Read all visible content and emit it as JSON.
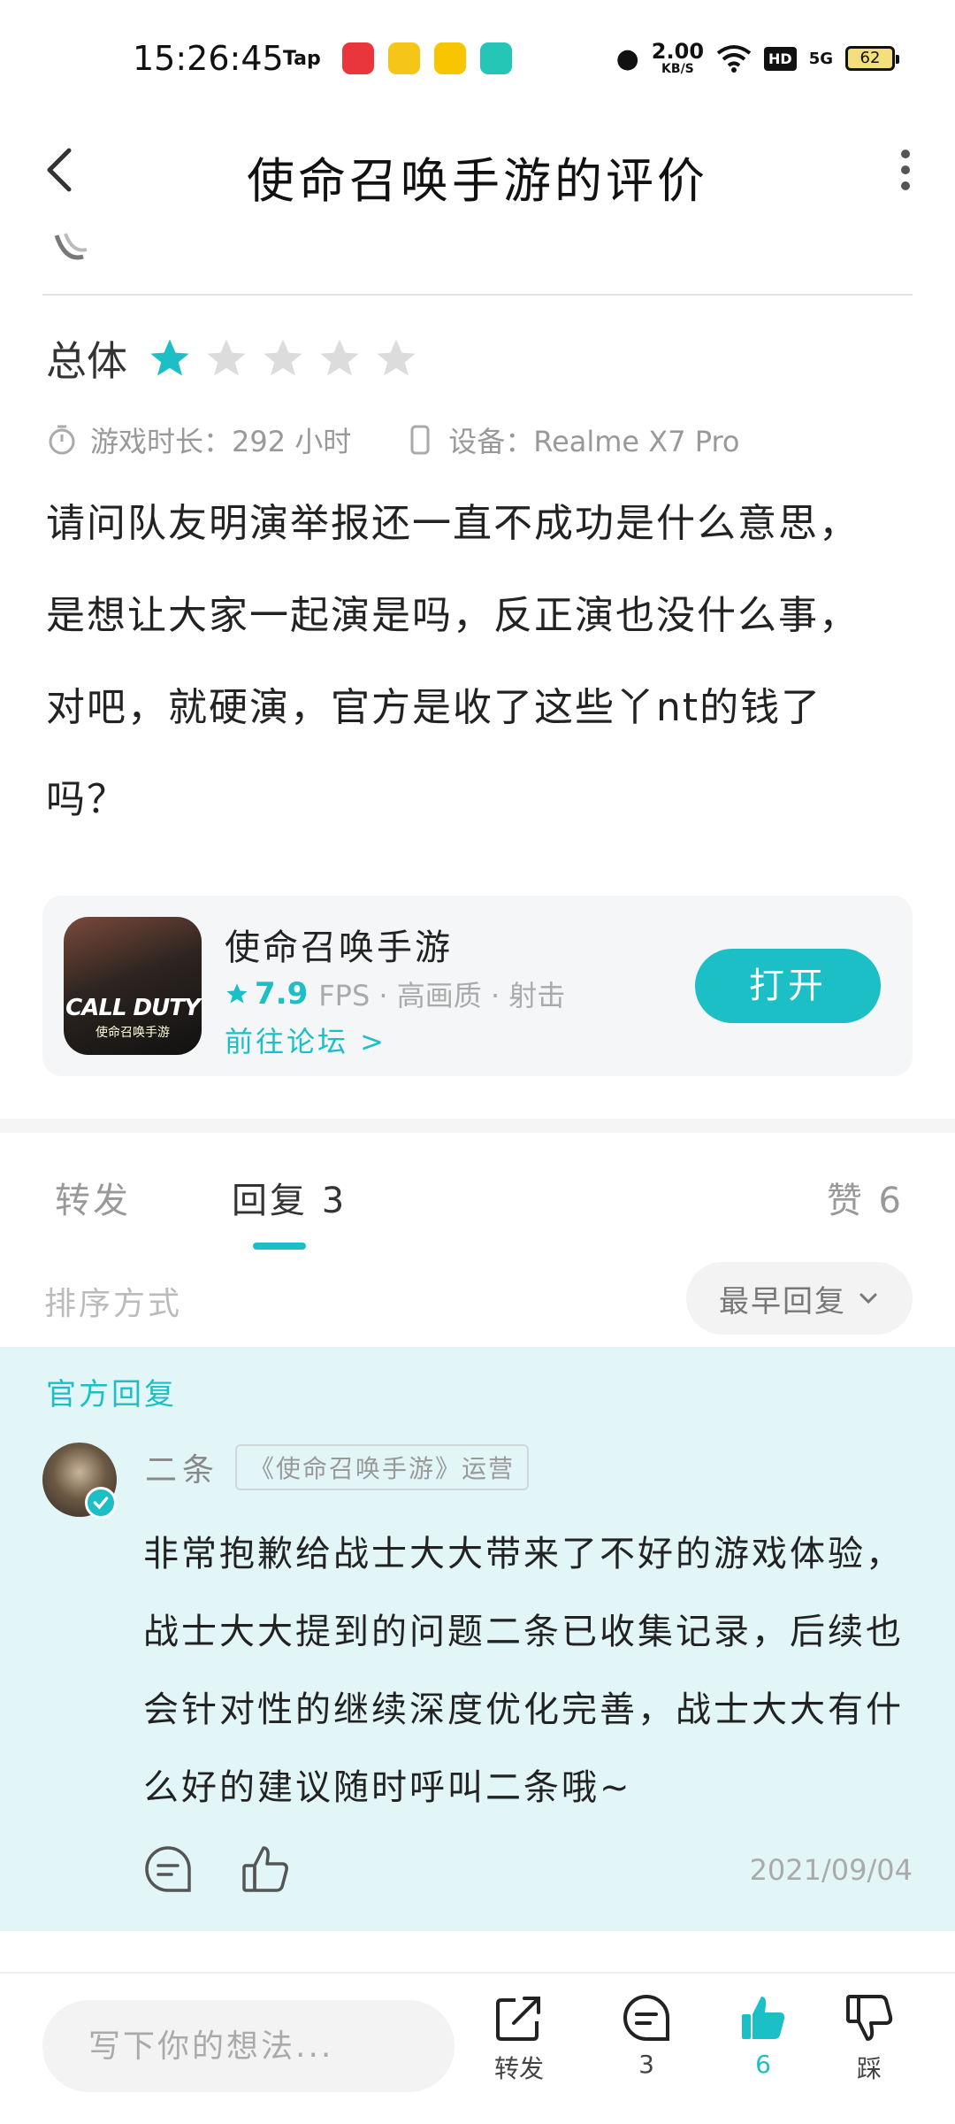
{
  "status_bar": {
    "time": "15:26:45",
    "tap_label": "Tap",
    "speed_value": "2.00",
    "speed_unit": "KB/S",
    "hd": "HD",
    "network": "5G",
    "battery": "62"
  },
  "nav": {
    "title": "使命召唤手游的评价"
  },
  "review": {
    "rating_label": "总体",
    "rating_value": 1,
    "rating_max": 5,
    "playtime": "游戏时长：292 小时",
    "device": "设备：Realme X7 Pro",
    "text": "请问队友明演举报还一直不成功是什么意思，是想让大家一起演是吗，反正演也没什么事，对吧，就硬演，官方是收了这些丫nt的钱了吗？"
  },
  "game_card": {
    "name": "使命召唤手游",
    "icon_title": "CALL DUTY",
    "icon_subtitle": "使命召唤手游",
    "score": "7.9",
    "tags": "FPS · 高画质 · 射击",
    "forum_link": "前往论坛 >",
    "open_button": "打开"
  },
  "tabs": {
    "repost": "转发",
    "reply": "回复 3",
    "likes": "赞 6"
  },
  "sort": {
    "label": "排序方式",
    "value": "最早回复"
  },
  "official_reply": {
    "section_label": "官方回复",
    "author": "二条",
    "author_tag": "《使命召唤手游》运营",
    "text": "非常抱歉给战士大大带来了不好的游戏体验，战士大大提到的问题二条已收集记录，后续也会针对性的继续深度优化完善，战士大大有什么好的建议随时呼叫二条哦~",
    "date": "2021/09/04"
  },
  "bottom_bar": {
    "input_placeholder": "写下你的想法...",
    "share_label": "转发",
    "comment_count": "3",
    "like_count": "6",
    "dislike_label": "踩"
  },
  "colors": {
    "accent": "#1dbfc6",
    "official_bg": "#e3f6f7",
    "star_empty": "#dcdcdc"
  }
}
